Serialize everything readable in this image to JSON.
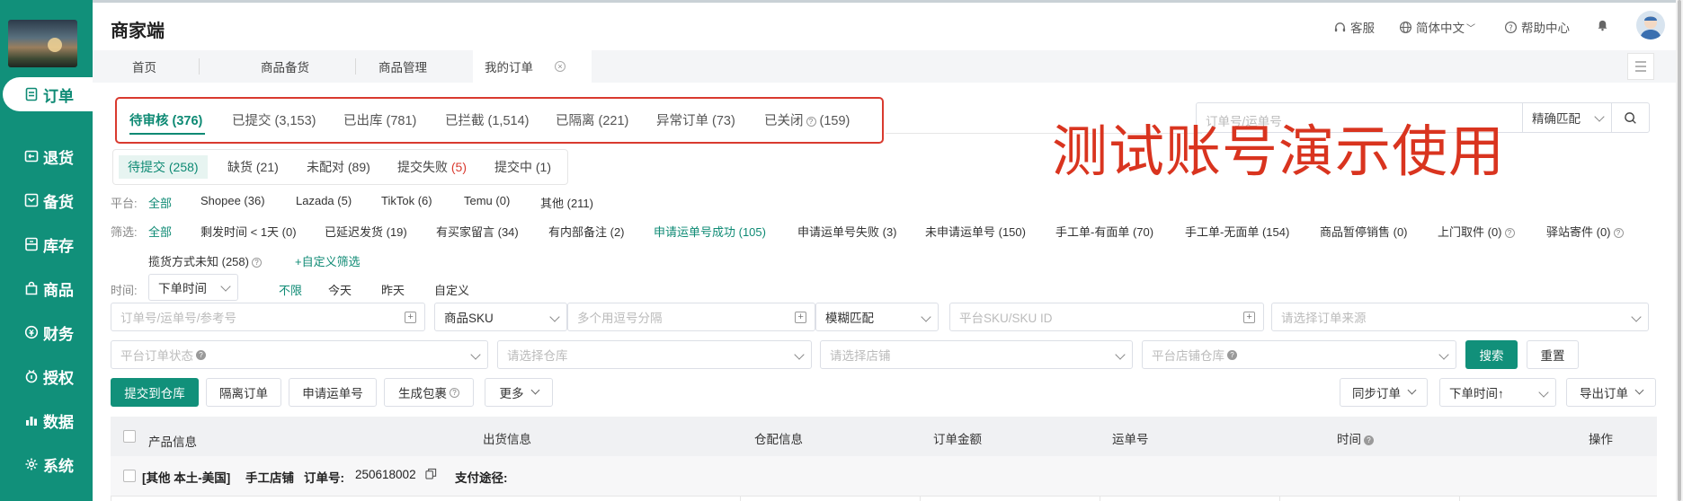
{
  "sidebar": {
    "items": [
      {
        "label": "订单",
        "icon": "order-icon",
        "active": true
      },
      {
        "label": "退货",
        "icon": "return-icon",
        "active": false
      },
      {
        "label": "备货",
        "icon": "stock-prep-icon",
        "active": false
      },
      {
        "label": "库存",
        "icon": "inventory-icon",
        "active": false
      },
      {
        "label": "商品",
        "icon": "product-icon",
        "active": false
      },
      {
        "label": "财务",
        "icon": "finance-icon",
        "active": false
      },
      {
        "label": "授权",
        "icon": "authorize-icon",
        "active": false
      },
      {
        "label": "数据",
        "icon": "data-icon",
        "active": false
      },
      {
        "label": "系统",
        "icon": "system-icon",
        "active": false
      }
    ]
  },
  "header": {
    "title": "商家端",
    "customer_service": "客服",
    "language": "简体中文",
    "help_center": "帮助中心"
  },
  "page_tabs": [
    {
      "label": "首页"
    },
    {
      "label": "商品备货"
    },
    {
      "label": "商品管理"
    },
    {
      "label": "我的订单",
      "active": true
    }
  ],
  "status_tabs": [
    {
      "label": "待审核 (376)",
      "active": true
    },
    {
      "label": "已提交 (3,153)"
    },
    {
      "label": "已出库 (781)"
    },
    {
      "label": "已拦截 (1,514)"
    },
    {
      "label": "已隔离 (221)"
    },
    {
      "label": "异常订单 (73)"
    },
    {
      "label": "已关闭",
      "count": "(159)"
    }
  ],
  "watermark": "测试账号演示使用",
  "top_search": {
    "placeholder": "订单号/运单号",
    "match_mode": "精确匹配"
  },
  "sub_tabs": [
    {
      "label": "待提交 (258)",
      "active": true
    },
    {
      "label": "缺货 (21)"
    },
    {
      "label": "未配对 (89)"
    },
    {
      "label": "提交失败",
      "count": "(5)"
    },
    {
      "label": "提交中 (1)"
    }
  ],
  "platform_filter": {
    "label": "平台:",
    "options": [
      "全部",
      "Shopee (36)",
      "Lazada (5)",
      "TikTok (6)",
      "Temu (0)",
      "其他 (211)"
    ]
  },
  "screen_filter": {
    "label": "筛选:",
    "options": [
      "全部",
      "剩发时间 < 1天 (0)",
      "已延迟发货 (19)",
      "有买家留言 (34)",
      "有内部备注 (2)",
      "申请运单号成功 (105)",
      "申请运单号失败 (3)",
      "未申请运单号 (150)",
      "手工单-有面单 (70)",
      "手工单-无面单 (154)",
      "商品暂停销售 (0)",
      "上门取件 (0)",
      "驿站寄件 (0)"
    ],
    "row2": [
      "揽货方式未知 (258)"
    ],
    "custom": "+自定义筛选"
  },
  "time_filter": {
    "label": "时间:",
    "select": "下单时间",
    "options": [
      "不限",
      "今天",
      "昨天",
      "自定义"
    ]
  },
  "search_fields": {
    "order_no_placeholder": "订单号/运单号/参考号",
    "sku_type": "商品SKU",
    "multi_placeholder": "多个用逗号分隔",
    "fuzzy": "模糊匹配",
    "platform_sku_placeholder": "平台SKU/SKU ID",
    "source_placeholder": "请选择订单来源",
    "platform_status_placeholder": "平台订单状态",
    "warehouse_placeholder": "请选择仓库",
    "shop_placeholder": "请选择店铺",
    "shop_warehouse_placeholder": "平台店铺仓库",
    "search_button": "搜索",
    "reset_button": "重置"
  },
  "actions": {
    "submit_warehouse": "提交到仓库",
    "isolate": "隔离订单",
    "apply_tracking": "申请运单号",
    "generate_package": "生成包裹",
    "more": "更多",
    "sync_orders": "同步订单",
    "sort_by": "下单时间↑",
    "export": "导出订单"
  },
  "table": {
    "columns": [
      "产品信息",
      "出货信息",
      "仓配信息",
      "订单金额",
      "运单号",
      "时间",
      "操作"
    ]
  },
  "order": {
    "tag": "[其他 本土-美国]",
    "shop": "手工店铺",
    "order_label": "订单号:",
    "order_no": "250618002",
    "payment_label": "支付途径:"
  },
  "colors": {
    "primary": "#11907a",
    "annotation_red": "#d93a2f"
  }
}
